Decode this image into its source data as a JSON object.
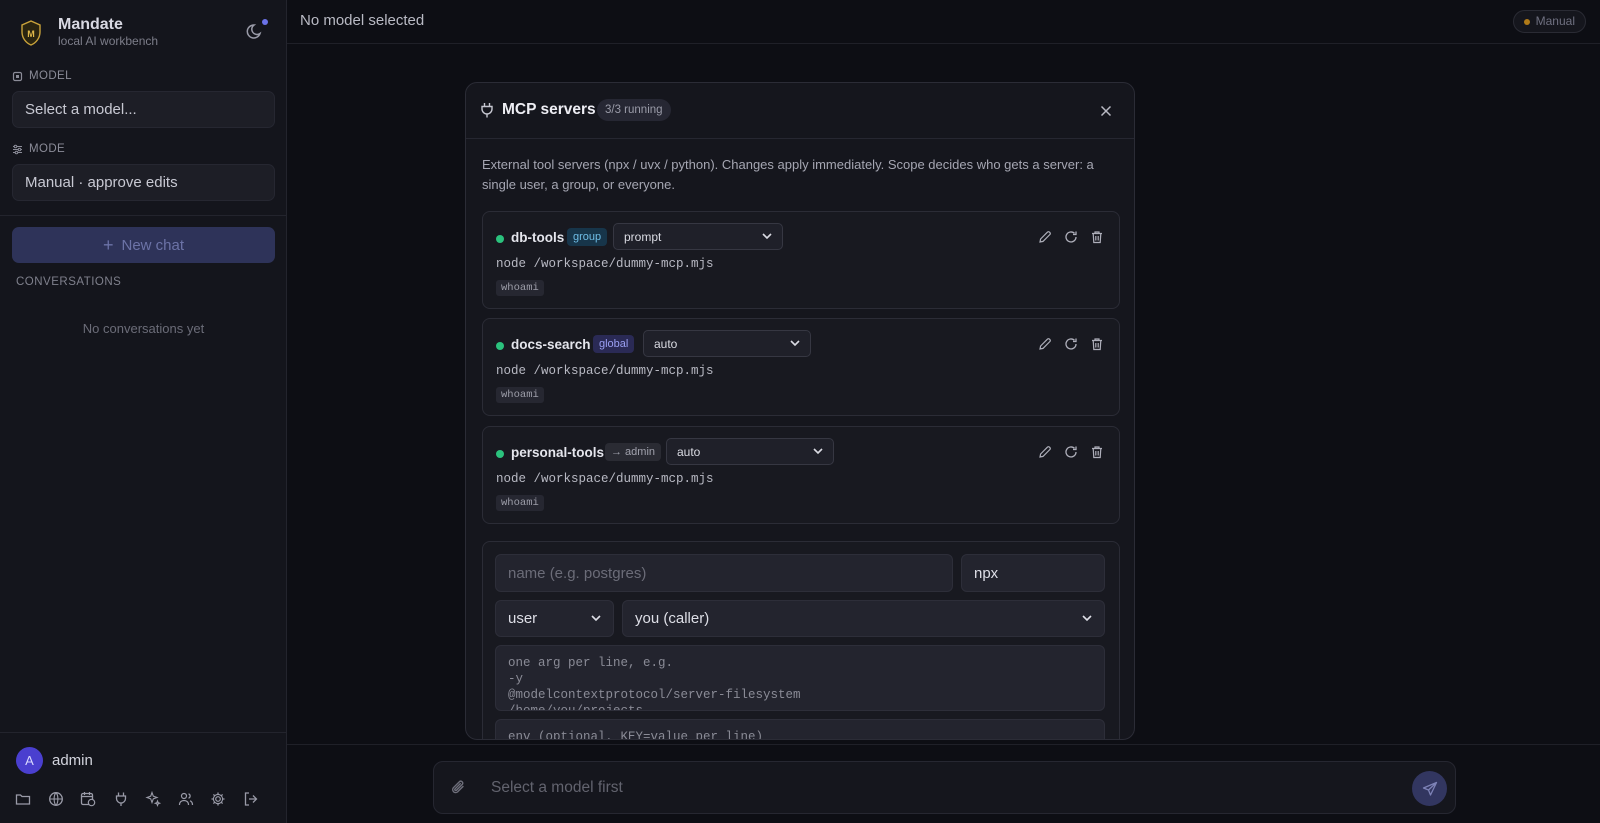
{
  "app": {
    "name": "Mandate",
    "subtitle": "local AI workbench"
  },
  "sidebar": {
    "model_label": "MODEL",
    "model_placeholder": "Select a model...",
    "mode_label": "MODE",
    "mode_value": "Manual · approve edits",
    "new_chat": "New chat",
    "conversations_label": "CONVERSATIONS",
    "empty_conversations": "No conversations yet",
    "user": {
      "initial": "A",
      "name": "admin"
    },
    "footer_icons": [
      "folder-icon",
      "globe-icon",
      "calendar-clock-icon",
      "plug-icon",
      "sparkles-icon",
      "users-icon",
      "settings-icon",
      "logout-icon"
    ]
  },
  "topbar": {
    "title": "No model selected",
    "mode_pill": "Manual"
  },
  "composer": {
    "placeholder": "Select a model first"
  },
  "modal": {
    "title": "MCP servers",
    "running_badge": "3/3 running",
    "description": "External tool servers (npx / uvx / python). Changes apply immediately. Scope decides who gets a server: a single user, a group, or everyone.",
    "servers": [
      {
        "name": "db-tools",
        "scope": "group",
        "policy": "prompt",
        "command": "node /workspace/dummy-mcp.mjs",
        "tools": [
          "whoami"
        ],
        "status": "running"
      },
      {
        "name": "docs-search",
        "scope": "global",
        "policy": "auto",
        "command": "node /workspace/dummy-mcp.mjs",
        "tools": [
          "whoami"
        ],
        "status": "running"
      },
      {
        "name": "personal-tools",
        "scope": "→ admin",
        "policy": "auto",
        "command": "node /workspace/dummy-mcp.mjs",
        "tools": [
          "whoami"
        ],
        "status": "running"
      }
    ],
    "add_form": {
      "name_placeholder": "name (e.g. postgres)",
      "command_value": "npx",
      "scope_value": "user",
      "target_value": "you (caller)",
      "args_placeholder": "one arg per line, e.g.\n-y\n@modelcontextprotocol/server-filesystem\n/home/you/projects",
      "env_placeholder": "env (optional, KEY=value per line)"
    }
  },
  "colors": {
    "accent": "#4a3fcf",
    "running": "#2bc27d",
    "manual_dot": "#b07a18"
  }
}
